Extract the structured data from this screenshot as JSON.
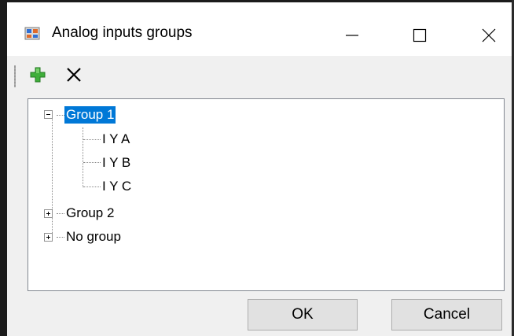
{
  "window": {
    "title": "Analog inputs groups",
    "minimize_icon": "minimize-icon",
    "maximize_icon": "maximize-icon",
    "close_icon": "close-icon"
  },
  "toolbar": {
    "add_icon": "add-icon",
    "delete_icon": "delete-icon"
  },
  "tree": {
    "nodes": [
      {
        "label": "Group 1",
        "expanded": true,
        "selected": true,
        "children": [
          {
            "label": "I Y A"
          },
          {
            "label": "I Y B"
          },
          {
            "label": "I Y C"
          }
        ]
      },
      {
        "label": "Group 2",
        "expanded": false,
        "selected": false
      },
      {
        "label": "No group",
        "expanded": false,
        "selected": false
      }
    ]
  },
  "buttons": {
    "ok_label": "OK",
    "cancel_label": "Cancel"
  },
  "colors": {
    "selection": "#0078d7",
    "add_green": "#2ea043"
  }
}
